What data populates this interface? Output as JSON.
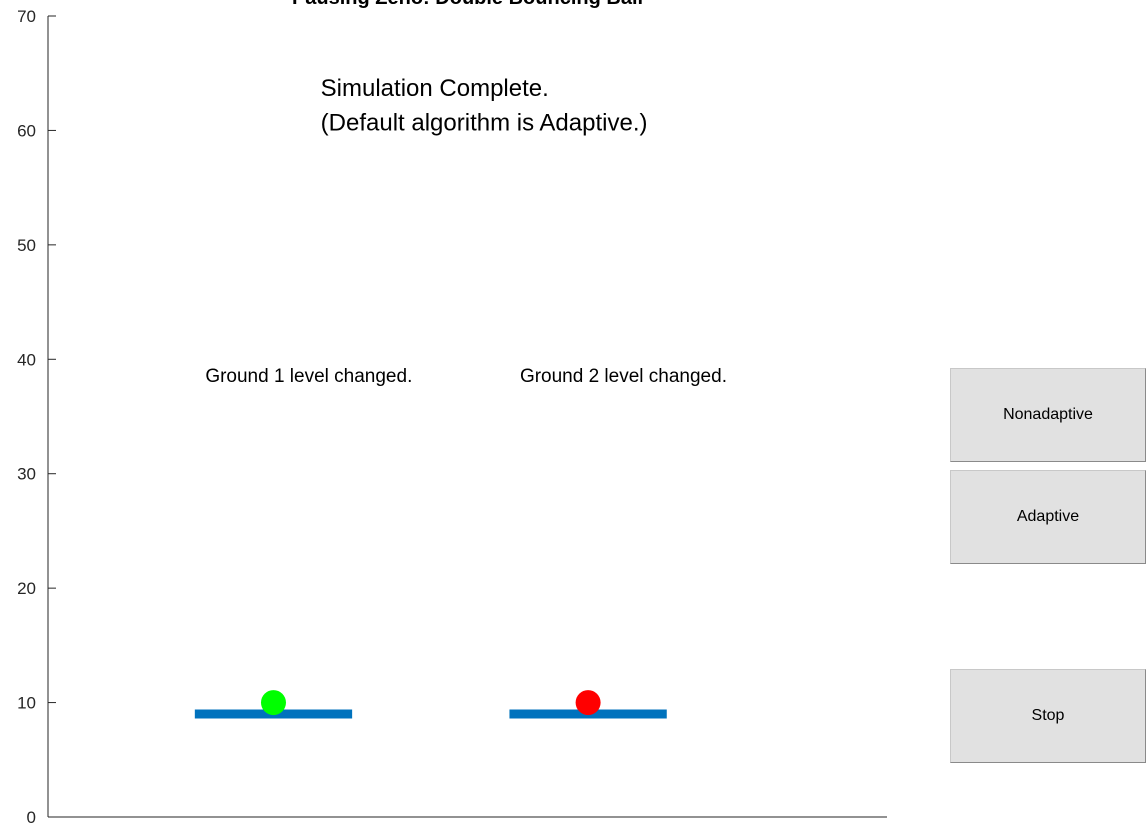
{
  "axes": {
    "title": "Pausing Zeno: Double Bouncing Ball",
    "y_ticks": [
      "0",
      "10",
      "20",
      "30",
      "40",
      "50",
      "60",
      "70"
    ]
  },
  "status": {
    "line1": "Simulation Complete.",
    "line2": "(Default algorithm is Adaptive.)"
  },
  "grounds": [
    {
      "label": "Ground 1 level changed.",
      "ball_color": "#00ff00"
    },
    {
      "label": "Ground 2 level changed.",
      "ball_color": "#ff0000"
    }
  ],
  "colors": {
    "ground_bar": "#0072bd",
    "ball_1": "#00ff00",
    "ball_2": "#ff0000",
    "button_face": "#e1e1e1"
  },
  "buttons": {
    "nonadaptive": "Nonadaptive",
    "adaptive": "Adaptive",
    "stop": "Stop"
  },
  "chart_data": {
    "type": "scatter",
    "title": "Pausing Zeno: Double Bouncing Ball",
    "ylim": [
      0,
      70
    ],
    "yticks": [
      0,
      10,
      20,
      30,
      40,
      50,
      60,
      70
    ],
    "grid": false,
    "grounds": [
      {
        "x_range": [
          -6.4,
          -0.4
        ],
        "y": 9
      },
      {
        "x_range": [
          5.6,
          11.6
        ],
        "y": 9
      }
    ],
    "balls": [
      {
        "x": -3.4,
        "y": 10,
        "color": "#00ff00"
      },
      {
        "x": 8.6,
        "y": 10,
        "color": "#ff0000"
      }
    ],
    "annotations": [
      {
        "text": "Simulation Complete.",
        "x": -1.6,
        "y": 63
      },
      {
        "text": "(Default algorithm is Adaptive.)",
        "x": -1.6,
        "y": 60
      },
      {
        "text": "Ground 1 level changed.",
        "x": -6.0,
        "y": 38
      },
      {
        "text": "Ground 2 level changed.",
        "x": 6.0,
        "y": 38
      }
    ]
  }
}
